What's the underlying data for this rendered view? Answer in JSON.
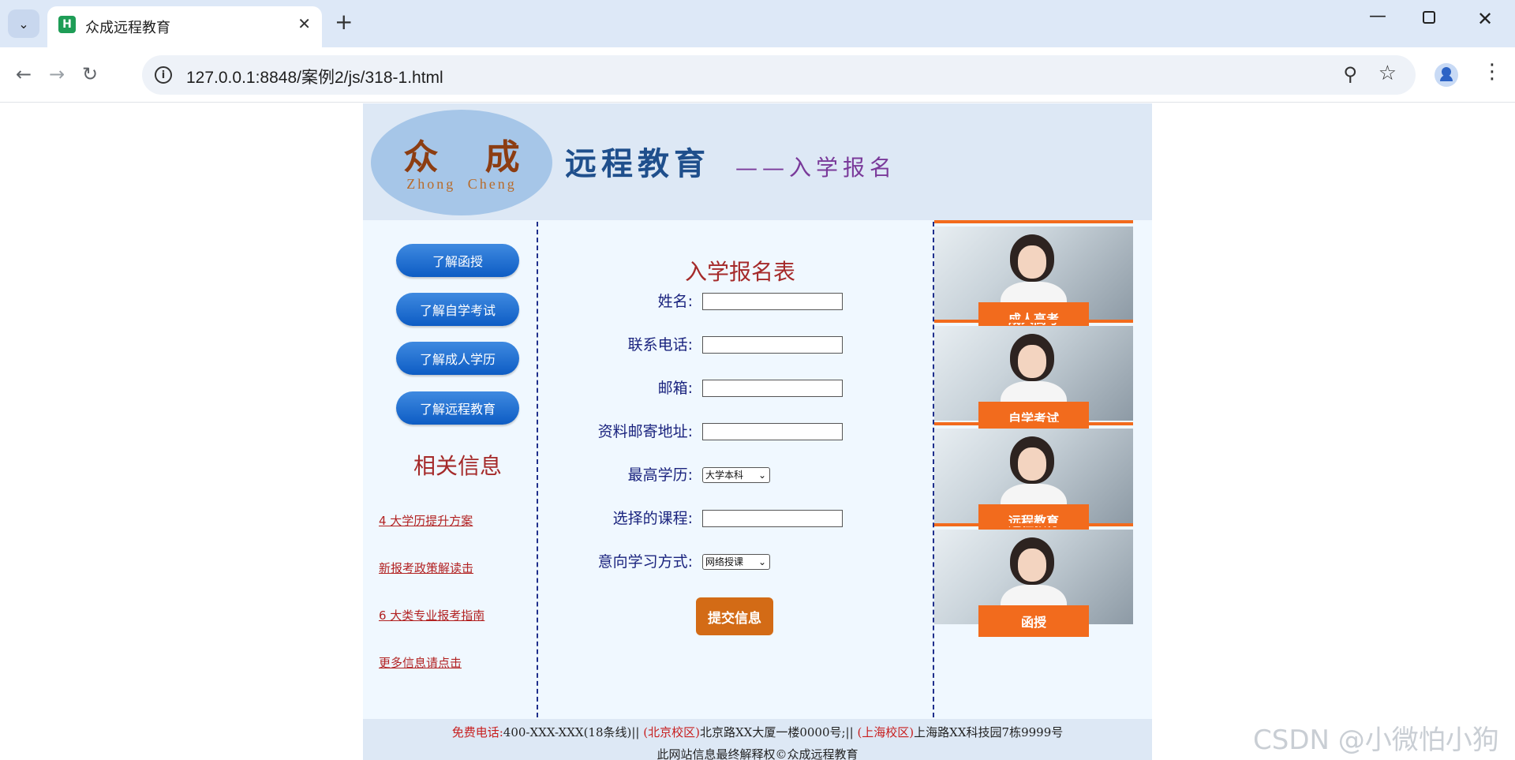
{
  "browser": {
    "tab_title": "众成远程教育",
    "favicon_letter": "H",
    "url": "127.0.0.1:8848/案例2/js/318-1.html"
  },
  "header": {
    "logo_main": "众 成",
    "logo_sub": "Zhong Cheng",
    "title": "远程教育",
    "subtitle": "——入学报名"
  },
  "sidebar": {
    "buttons": [
      "了解函授",
      "了解自学考试",
      "了解成人学历",
      "了解远程教育"
    ],
    "related_title": "相关信息",
    "links": [
      "4 大学历提升方案",
      "新报考政策解读击",
      "6 大类专业报考指南",
      "更多信息请点击"
    ]
  },
  "form": {
    "title": "入学报名表",
    "fields": [
      {
        "label": "姓名:",
        "value": ""
      },
      {
        "label": "联系电话:",
        "value": ""
      },
      {
        "label": "邮箱:",
        "value": ""
      },
      {
        "label": "资料邮寄地址:",
        "value": ""
      },
      {
        "label": "最高学历:",
        "selected": "大学本科"
      },
      {
        "label": "选择的课程:",
        "value": ""
      },
      {
        "label": "意向学习方式:",
        "selected": "网络授课"
      }
    ],
    "submit_label": "提交信息"
  },
  "promos": [
    "成人高考",
    "自学考试",
    "远程教育",
    "函授"
  ],
  "footer": {
    "phone_label": "免费电话:",
    "phone": "400-XXX-XXX(18条线)||",
    "beijing_label": "(北京校区)",
    "beijing": "北京路XX大厦一楼0000号;||",
    "shanghai_label": "(上海校区)",
    "shanghai": "上海路XX科技园7栋9999号",
    "copyright": "此网站信息最终解释权©众成远程教育"
  },
  "watermark": "CSDN @小微怕小狗",
  "colors": {
    "accent_orange": "#f26b1d",
    "button_blue": "#1565d8",
    "heading_red": "#a52a2a",
    "page_bg": "#f0f8ff"
  }
}
